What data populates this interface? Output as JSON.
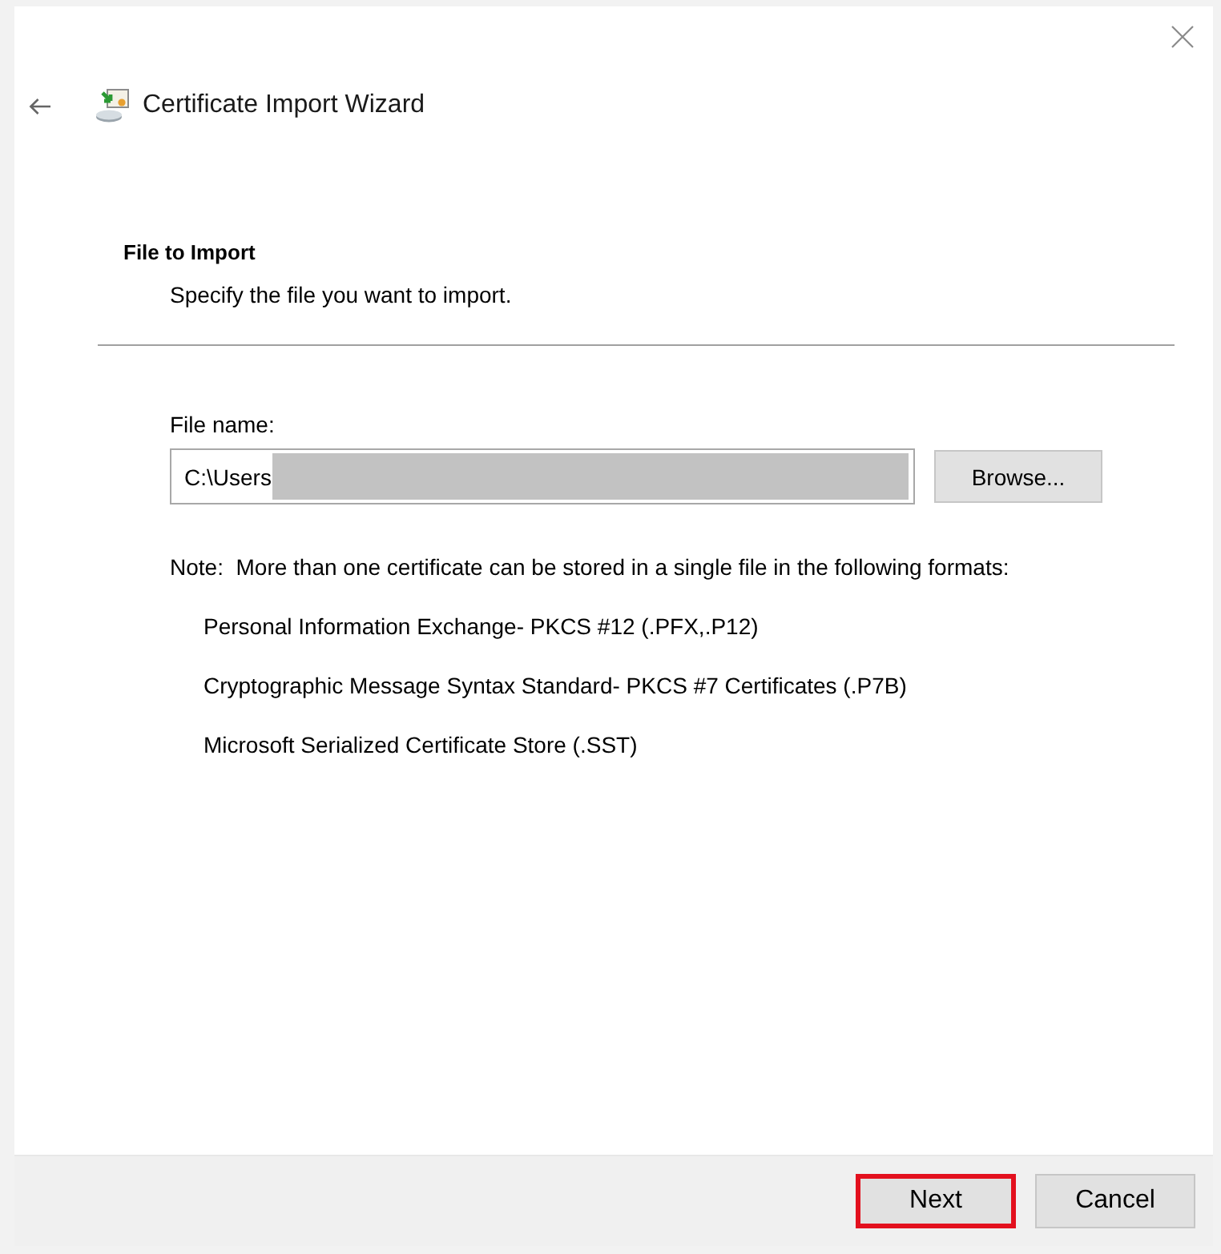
{
  "window": {
    "title": "Certificate Import Wizard"
  },
  "page": {
    "heading": "File to Import",
    "subheading": "Specify the file you want to import."
  },
  "file_name": {
    "label": "File name:",
    "value": "C:\\Users",
    "redacted": true,
    "browse_button": "Browse..."
  },
  "note": "Note:  More than one certificate can be stored in a single file in the following formats:",
  "formats": [
    "Personal Information Exchange- PKCS #12 (.PFX,.P12)",
    "Cryptographic Message Syntax Standard- PKCS #7 Certificates (.P7B)",
    "Microsoft Serialized Certificate Store (.SST)"
  ],
  "buttons": [
    {
      "label": "Next",
      "highlighted": true
    },
    {
      "label": "Cancel",
      "highlighted": false
    }
  ]
}
